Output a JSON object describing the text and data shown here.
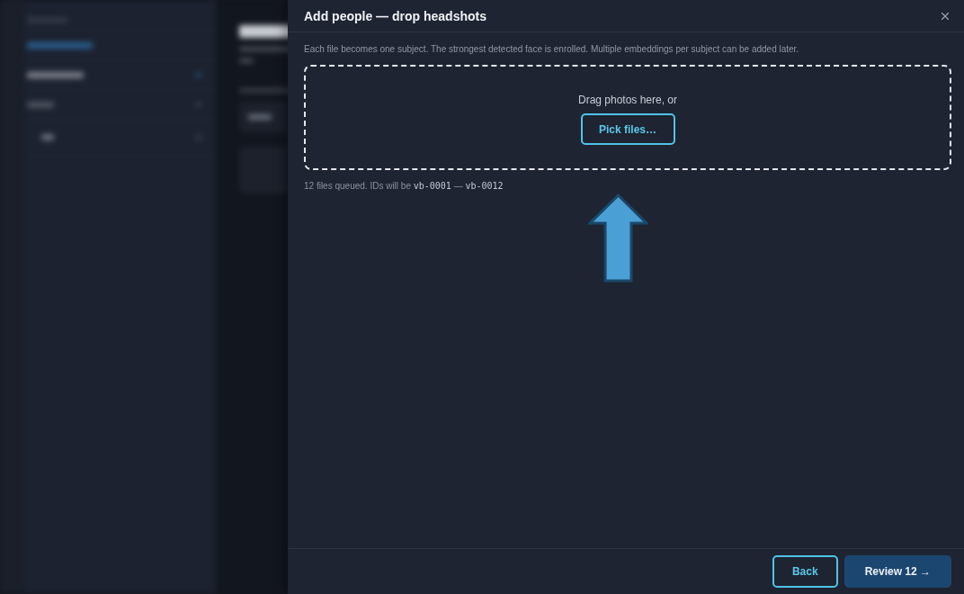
{
  "drawer": {
    "title": "Add people — drop headshots",
    "description": "Each file becomes one subject. The strongest detected face is enrolled. Multiple embeddings per subject can be added later.",
    "dropzone": {
      "prompt": "Drag photos here, or",
      "button": "Pick files…"
    },
    "queue_note": {
      "text": "12 files queued. IDs will be",
      "first_id": "vb-0001",
      "separator": "—",
      "last_id": "vb-0012"
    }
  },
  "footer": {
    "buttons": [
      {
        "label": "Back",
        "kind": "secondary"
      },
      {
        "label": "Review 12 →",
        "kind": "primary"
      }
    ]
  }
}
